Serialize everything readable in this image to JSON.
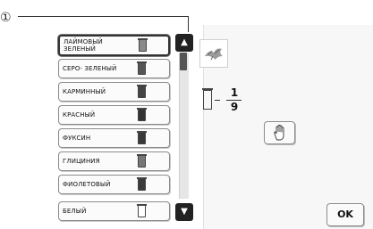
{
  "callout": {
    "number": "①"
  },
  "colors": [
    {
      "label": "ЛАЙМОВЫЙ ЗЕЛЕНЫЙ",
      "spool_color": "#8a8a8a",
      "selected": true
    },
    {
      "label": "СЕРО- ЗЕЛЕНЫЙ",
      "spool_color": "#555555",
      "selected": false
    },
    {
      "label": "КАРМИННЫЙ",
      "spool_color": "#444444",
      "selected": false
    },
    {
      "label": "КРАСНЫЙ",
      "spool_color": "#333333",
      "selected": false
    },
    {
      "label": "ФУКСИН",
      "spool_color": "#3a3a3a",
      "selected": false
    },
    {
      "label": "ГЛИЦИНИЯ",
      "spool_color": "#777777",
      "selected": false
    },
    {
      "label": "ФИОЛЕТОВЫЙ",
      "spool_color": "#3a3a3a",
      "selected": false
    },
    {
      "label": "БЕЛЫЙ",
      "spool_color": "#ffffff",
      "selected": false
    }
  ],
  "counter": {
    "current": "1",
    "total": "9"
  },
  "buttons": {
    "ok_label": "OK"
  },
  "icons": {
    "scroll_up": "triangle-up-icon",
    "scroll_down": "triangle-down-icon",
    "preview": "embroidery-preview-icon",
    "hand": "hand-icon",
    "spool": "thread-spool-icon"
  }
}
